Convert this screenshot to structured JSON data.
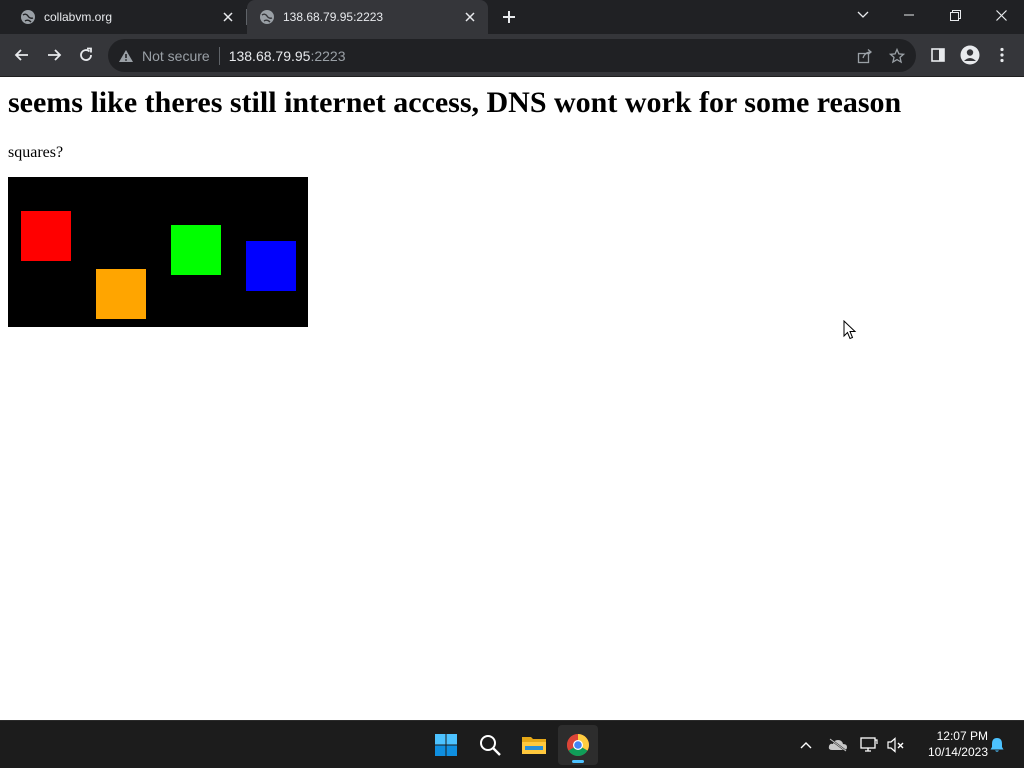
{
  "browser": {
    "tabs": [
      {
        "title": "collabvm.org",
        "active": false
      },
      {
        "title": "138.68.79.95:2223",
        "active": true
      }
    ],
    "security_label": "Not secure",
    "url_host": "138.68.79.95",
    "url_port": ":2223"
  },
  "page": {
    "heading": "seems like theres still internet access, DNS wont work for some reason",
    "paragraph": "squares?",
    "squares": [
      {
        "color": "#ff0000"
      },
      {
        "color": "#ffa500"
      },
      {
        "color": "#00ff00"
      },
      {
        "color": "#0000ff"
      }
    ]
  },
  "taskbar": {
    "apps": [
      "start",
      "search",
      "file-explorer",
      "chrome"
    ],
    "active_app": "chrome",
    "clock_time": "12:07 PM",
    "clock_date": "10/14/2023"
  }
}
